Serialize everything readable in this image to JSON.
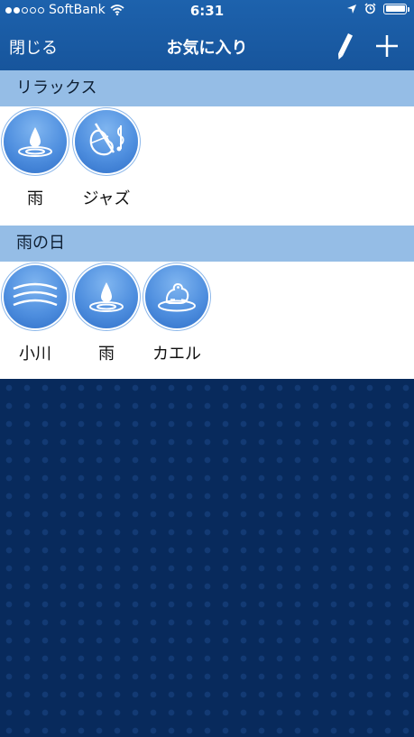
{
  "status_bar": {
    "carrier": "SoftBank",
    "time": "6:31",
    "signal_bars": 2
  },
  "nav": {
    "close_label": "閉じる",
    "title": "お気に入り",
    "edit_icon": "pencil-icon",
    "add_icon": "plus-icon"
  },
  "sections": [
    {
      "title": "リラックス",
      "items": [
        {
          "label": "雨",
          "icon": "rain-drop-icon"
        },
        {
          "label": "ジャズ",
          "icon": "cello-icon"
        }
      ]
    },
    {
      "title": "雨の日",
      "items": [
        {
          "label": "小川",
          "icon": "waves-icon"
        },
        {
          "label": "雨",
          "icon": "rain-drop-icon"
        },
        {
          "label": "カエル",
          "icon": "frog-icon"
        }
      ]
    }
  ],
  "colors": {
    "nav_bar": "#1a5ba4",
    "section_header": "#95bde6",
    "background": "#082a5c",
    "icon_circle": "#4f8fdf"
  }
}
